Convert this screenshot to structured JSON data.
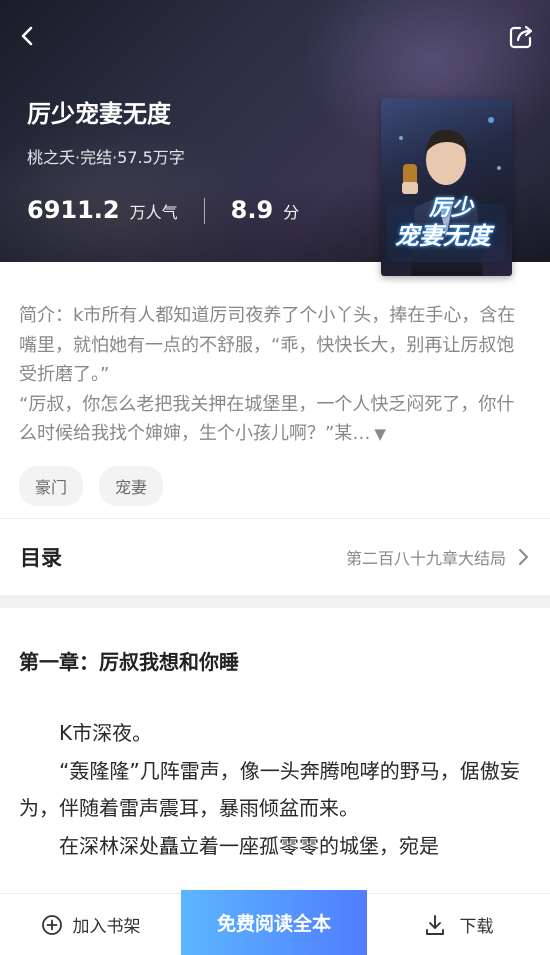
{
  "header": {
    "title": "厉少宠妻无度",
    "meta": "桃之夭·完结·57.5万字",
    "popularity_value": "6911.2",
    "popularity_unit": "万人气",
    "score_value": "8.9",
    "score_unit": "分",
    "cover_title_line1": "厉少",
    "cover_title_line2": "宠妻无度"
  },
  "icons": {
    "back": "chevron-left-icon",
    "share": "share-icon",
    "toc_chevron": "chevron-right-icon",
    "add_shelf": "plus-circle-icon",
    "download": "download-icon"
  },
  "intro": {
    "line1": "简介：k市所有人都知道厉司夜养了个小丫头，捧在手心，含在嘴里，就怕她有一点的不舒服，“乖，快快长大，别再让厉叔饱受折磨了。”",
    "line2": "“厉叔，你怎么老把我关押在城堡里，一个人快乏闷死了，你什么时候给我找个婶婶，生个小孩儿啊？”某…",
    "more": "▼"
  },
  "tags": [
    "豪门",
    "宠妻"
  ],
  "toc": {
    "label": "目录",
    "latest": "第二百八十九章大结局"
  },
  "chapter": {
    "title": "第一章：厉叔我想和你睡",
    "paragraphs": [
      "K市深夜。",
      "“轰隆隆”几阵雷声，像一头奔腾咆哮的野马，倨傲妄为，伴随着雷声震耳，暴雨倾盆而来。",
      "在深林深处矗立着一座孤零零的城堡，宛是"
    ]
  },
  "bottom_bar": {
    "add_shelf": "加入书架",
    "read_all": "免费阅读全本",
    "download": "下载"
  },
  "colors": {
    "accent_gradient_start": "#5cb6ff",
    "accent_gradient_end": "#4f7dff",
    "tag_bg": "#f3f3f3"
  }
}
